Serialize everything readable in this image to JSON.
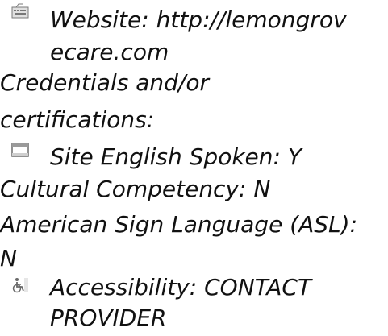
{
  "website": {
    "icon": "keyboard-icon",
    "label_line1": "Website: http://lemongrov",
    "label_line2": "ecare.com"
  },
  "credentials": {
    "line1": "Credentials and/or",
    "line2": "certifications:"
  },
  "site_english": {
    "icon": "window-icon",
    "label": "Site English Spoken: Y"
  },
  "cultural": {
    "label": "Cultural Competency: N"
  },
  "asl": {
    "line1": "American Sign Language (ASL):",
    "line2": "N"
  },
  "accessibility": {
    "icon": "wheelchair-icon",
    "line1": "Accessibility: CONTACT",
    "line2": "PROVIDER"
  }
}
